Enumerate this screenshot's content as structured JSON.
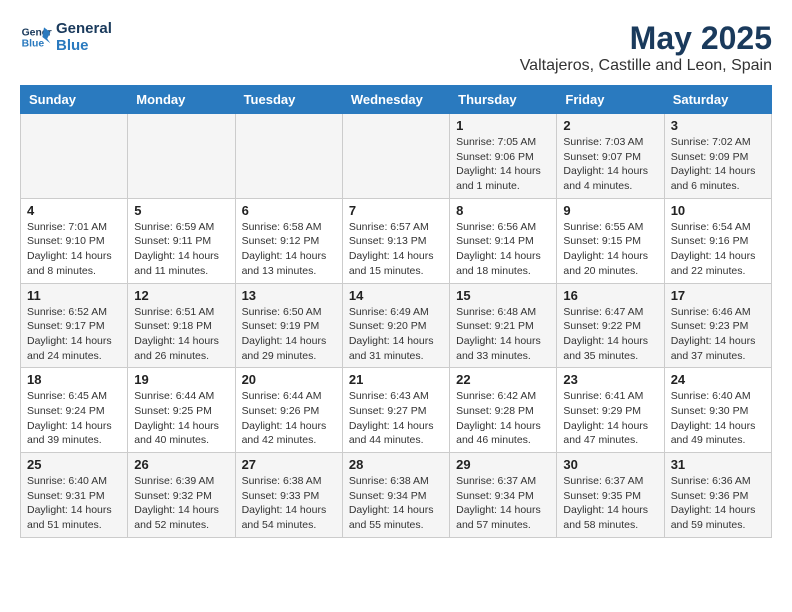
{
  "logo": {
    "line1": "General",
    "line2": "Blue"
  },
  "title": "May 2025",
  "location": "Valtajeros, Castille and Leon, Spain",
  "weekdays": [
    "Sunday",
    "Monday",
    "Tuesday",
    "Wednesday",
    "Thursday",
    "Friday",
    "Saturday"
  ],
  "weeks": [
    [
      {
        "day": "",
        "info": ""
      },
      {
        "day": "",
        "info": ""
      },
      {
        "day": "",
        "info": ""
      },
      {
        "day": "",
        "info": ""
      },
      {
        "day": "1",
        "info": "Sunrise: 7:05 AM\nSunset: 9:06 PM\nDaylight: 14 hours and 1 minute."
      },
      {
        "day": "2",
        "info": "Sunrise: 7:03 AM\nSunset: 9:07 PM\nDaylight: 14 hours and 4 minutes."
      },
      {
        "day": "3",
        "info": "Sunrise: 7:02 AM\nSunset: 9:09 PM\nDaylight: 14 hours and 6 minutes."
      }
    ],
    [
      {
        "day": "4",
        "info": "Sunrise: 7:01 AM\nSunset: 9:10 PM\nDaylight: 14 hours and 8 minutes."
      },
      {
        "day": "5",
        "info": "Sunrise: 6:59 AM\nSunset: 9:11 PM\nDaylight: 14 hours and 11 minutes."
      },
      {
        "day": "6",
        "info": "Sunrise: 6:58 AM\nSunset: 9:12 PM\nDaylight: 14 hours and 13 minutes."
      },
      {
        "day": "7",
        "info": "Sunrise: 6:57 AM\nSunset: 9:13 PM\nDaylight: 14 hours and 15 minutes."
      },
      {
        "day": "8",
        "info": "Sunrise: 6:56 AM\nSunset: 9:14 PM\nDaylight: 14 hours and 18 minutes."
      },
      {
        "day": "9",
        "info": "Sunrise: 6:55 AM\nSunset: 9:15 PM\nDaylight: 14 hours and 20 minutes."
      },
      {
        "day": "10",
        "info": "Sunrise: 6:54 AM\nSunset: 9:16 PM\nDaylight: 14 hours and 22 minutes."
      }
    ],
    [
      {
        "day": "11",
        "info": "Sunrise: 6:52 AM\nSunset: 9:17 PM\nDaylight: 14 hours and 24 minutes."
      },
      {
        "day": "12",
        "info": "Sunrise: 6:51 AM\nSunset: 9:18 PM\nDaylight: 14 hours and 26 minutes."
      },
      {
        "day": "13",
        "info": "Sunrise: 6:50 AM\nSunset: 9:19 PM\nDaylight: 14 hours and 29 minutes."
      },
      {
        "day": "14",
        "info": "Sunrise: 6:49 AM\nSunset: 9:20 PM\nDaylight: 14 hours and 31 minutes."
      },
      {
        "day": "15",
        "info": "Sunrise: 6:48 AM\nSunset: 9:21 PM\nDaylight: 14 hours and 33 minutes."
      },
      {
        "day": "16",
        "info": "Sunrise: 6:47 AM\nSunset: 9:22 PM\nDaylight: 14 hours and 35 minutes."
      },
      {
        "day": "17",
        "info": "Sunrise: 6:46 AM\nSunset: 9:23 PM\nDaylight: 14 hours and 37 minutes."
      }
    ],
    [
      {
        "day": "18",
        "info": "Sunrise: 6:45 AM\nSunset: 9:24 PM\nDaylight: 14 hours and 39 minutes."
      },
      {
        "day": "19",
        "info": "Sunrise: 6:44 AM\nSunset: 9:25 PM\nDaylight: 14 hours and 40 minutes."
      },
      {
        "day": "20",
        "info": "Sunrise: 6:44 AM\nSunset: 9:26 PM\nDaylight: 14 hours and 42 minutes."
      },
      {
        "day": "21",
        "info": "Sunrise: 6:43 AM\nSunset: 9:27 PM\nDaylight: 14 hours and 44 minutes."
      },
      {
        "day": "22",
        "info": "Sunrise: 6:42 AM\nSunset: 9:28 PM\nDaylight: 14 hours and 46 minutes."
      },
      {
        "day": "23",
        "info": "Sunrise: 6:41 AM\nSunset: 9:29 PM\nDaylight: 14 hours and 47 minutes."
      },
      {
        "day": "24",
        "info": "Sunrise: 6:40 AM\nSunset: 9:30 PM\nDaylight: 14 hours and 49 minutes."
      }
    ],
    [
      {
        "day": "25",
        "info": "Sunrise: 6:40 AM\nSunset: 9:31 PM\nDaylight: 14 hours and 51 minutes."
      },
      {
        "day": "26",
        "info": "Sunrise: 6:39 AM\nSunset: 9:32 PM\nDaylight: 14 hours and 52 minutes."
      },
      {
        "day": "27",
        "info": "Sunrise: 6:38 AM\nSunset: 9:33 PM\nDaylight: 14 hours and 54 minutes."
      },
      {
        "day": "28",
        "info": "Sunrise: 6:38 AM\nSunset: 9:34 PM\nDaylight: 14 hours and 55 minutes."
      },
      {
        "day": "29",
        "info": "Sunrise: 6:37 AM\nSunset: 9:34 PM\nDaylight: 14 hours and 57 minutes."
      },
      {
        "day": "30",
        "info": "Sunrise: 6:37 AM\nSunset: 9:35 PM\nDaylight: 14 hours and 58 minutes."
      },
      {
        "day": "31",
        "info": "Sunrise: 6:36 AM\nSunset: 9:36 PM\nDaylight: 14 hours and 59 minutes."
      }
    ]
  ]
}
